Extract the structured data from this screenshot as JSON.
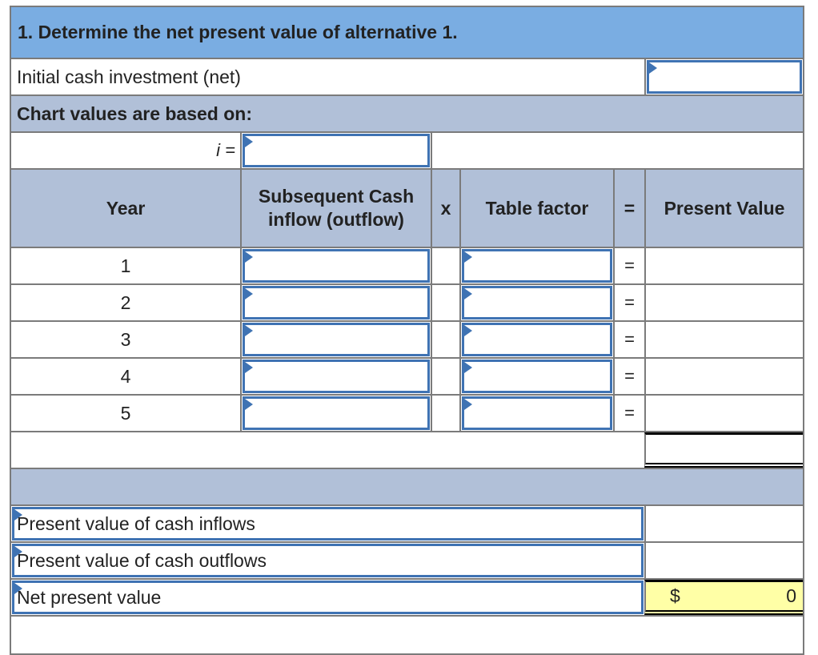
{
  "title": "1.  Determine the net present value of alternative 1.",
  "initial_investment": {
    "label": "Initial cash investment (net)",
    "value": ""
  },
  "chart_values": {
    "label": "Chart values are based on:"
  },
  "interest": {
    "label": "i =",
    "value": ""
  },
  "table": {
    "headers": {
      "year": "Year",
      "cash_flow_line1": "Subsequent Cash",
      "cash_flow_line2": "inflow (outflow)",
      "times": "x",
      "table_factor": "Table factor",
      "equals": "=",
      "present_value": "Present Value"
    },
    "rows": [
      {
        "year": "1",
        "cash_flow": "",
        "factor": "",
        "equals": "=",
        "present_value": ""
      },
      {
        "year": "2",
        "cash_flow": "",
        "factor": "",
        "equals": "=",
        "present_value": ""
      },
      {
        "year": "3",
        "cash_flow": "",
        "factor": "",
        "equals": "=",
        "present_value": ""
      },
      {
        "year": "4",
        "cash_flow": "",
        "factor": "",
        "equals": "=",
        "present_value": ""
      },
      {
        "year": "5",
        "cash_flow": "",
        "factor": "",
        "equals": "=",
        "present_value": ""
      }
    ],
    "total_present_value": ""
  },
  "summary": [
    {
      "label": "Present value of cash inflows",
      "value": ""
    },
    {
      "label": "Present value of cash outflows",
      "value": ""
    },
    {
      "label": "Net present value",
      "currency": "$",
      "value": "0"
    }
  ],
  "colors": {
    "title_bg": "#7aade2",
    "section_bg": "#b1c0d8",
    "input_border": "#3f73b3",
    "npv_bg": "#ffffa6"
  }
}
